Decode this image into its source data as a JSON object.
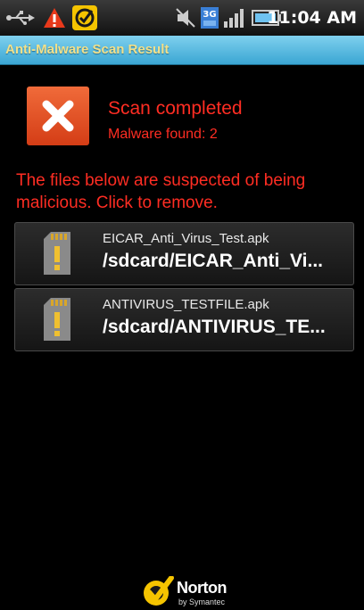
{
  "status_bar": {
    "time": "11:04 AM"
  },
  "header": {
    "title": "Anti-Malware Scan Result"
  },
  "result": {
    "title": "Scan completed",
    "subtitle": "Malware found: 2"
  },
  "warning": "The files below are suspected of being malicious. Click to remove.",
  "files": [
    {
      "name": "EICAR_Anti_Virus_Test.apk",
      "path": "/sdcard/EICAR_Anti_Vi..."
    },
    {
      "name": "ANTIVIRUS_TESTFILE.apk",
      "path": "/sdcard/ANTIVIRUS_TE..."
    }
  ],
  "footer": {
    "brand": "Norton",
    "tagline": "by Symantec"
  },
  "colors": {
    "accent_red": "#ff2d23",
    "title_bar": "#3aa6d3",
    "title_text": "#f3e08a"
  },
  "icons": [
    "usb-icon",
    "warning-icon",
    "norton-notification-icon",
    "mute-icon",
    "network-3g-icon",
    "signal-icon",
    "battery-icon",
    "close-icon",
    "sd-card-icon",
    "norton-logo-icon"
  ]
}
